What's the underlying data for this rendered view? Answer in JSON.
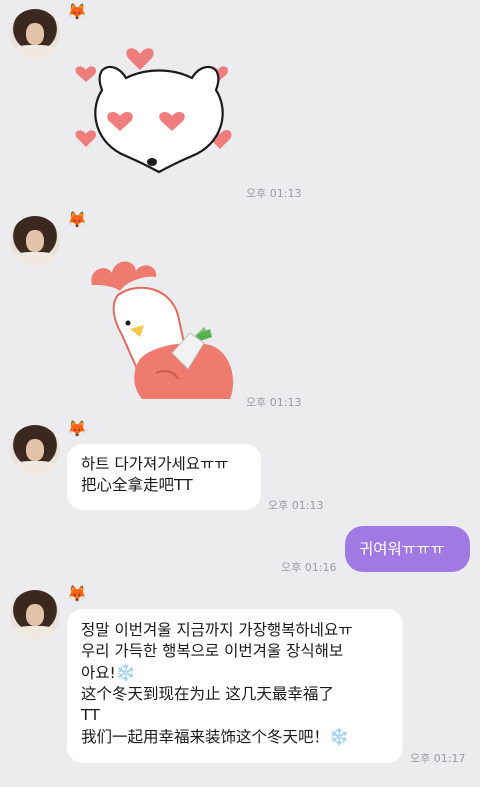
{
  "chat": {
    "msg1": {
      "sender_badge": "🦊",
      "time": "오후 01:13"
    },
    "msg2": {
      "sender_badge": "🦊",
      "time": "오후 01:13"
    },
    "msg3": {
      "sender_badge": "🦊",
      "lines": [
        "하트 다가져가세요ㅠㅠ",
        "把心全拿走吧TT"
      ],
      "time": "오후 01:13"
    },
    "msg4": {
      "text": "귀여워ㅠㅠㅠ",
      "time": "오후 01:16"
    },
    "msg5": {
      "sender_badge": "🦊",
      "lines": [
        "정말 이번겨울 지금까지 가장행복하네요ㅠ",
        "우리 가득한 행복으로 이번겨울 장식해보",
        "아요!",
        "这个冬天到现在为止 这几天最幸福了",
        "TT",
        "我们一起用幸福来装饰这个冬天吧！"
      ],
      "snowflake": "❄️",
      "time": "오후 01:17"
    }
  },
  "colors": {
    "background": "#ececee",
    "my_bubble": "#a179e3",
    "their_bubble": "#ffffff",
    "timestamp": "#9a9aa0"
  },
  "icons": [
    "fox-icon",
    "snowflake-icon",
    "mouse-heart-eyes-sticker",
    "chicken-sticker"
  ]
}
